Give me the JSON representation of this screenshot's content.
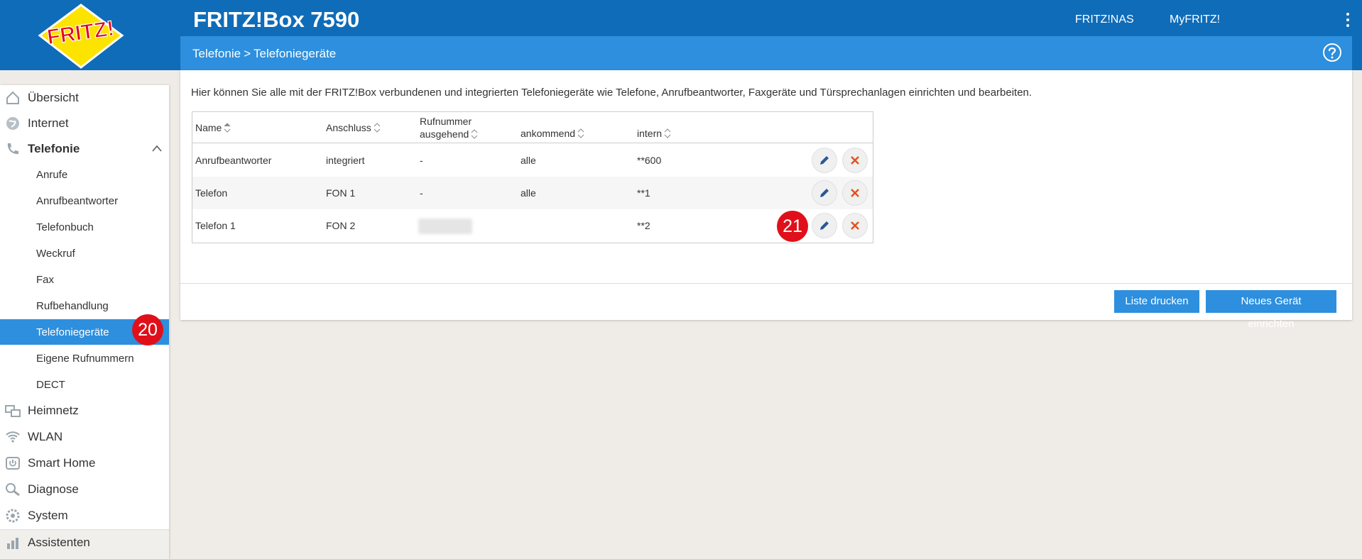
{
  "header": {
    "brand": "FRITZ!",
    "product": "FRITZ!Box 7590",
    "links": [
      "FRITZ!NAS",
      "MyFRITZ!"
    ]
  },
  "breadcrumb": {
    "parent": "Telefonie",
    "separator": ">",
    "current": "Telefoniegeräte"
  },
  "sidebar": {
    "items": [
      {
        "label": "Übersicht",
        "icon": "home-icon"
      },
      {
        "label": "Internet",
        "icon": "globe-icon"
      },
      {
        "label": "Telefonie",
        "icon": "phone-icon",
        "expanded": true
      },
      {
        "label": "Heimnetz",
        "icon": "network-icon"
      },
      {
        "label": "WLAN",
        "icon": "wifi-icon"
      },
      {
        "label": "Smart Home",
        "icon": "smarthome-icon"
      },
      {
        "label": "Diagnose",
        "icon": "diagnose-icon"
      },
      {
        "label": "System",
        "icon": "gear-icon"
      },
      {
        "label": "Assistenten",
        "icon": "wizard-icon"
      }
    ],
    "telefonie_sub": [
      "Anrufe",
      "Anrufbeantworter",
      "Telefonbuch",
      "Weckruf",
      "Fax",
      "Rufbehandlung",
      "Telefoniegeräte",
      "Eigene Rufnummern",
      "DECT"
    ],
    "selected_sub": "Telefoniegeräte"
  },
  "annotations": {
    "badge_a": "20",
    "badge_b": "21"
  },
  "main": {
    "intro": "Hier können Sie alle mit der FRITZ!Box verbundenen und integrierten Telefoniegeräte wie Telefone, Anrufbeantworter, Faxgeräte und Türsprechanlagen einrichten und bearbeiten.",
    "table": {
      "headers": {
        "name": "Name",
        "anschluss": "Anschluss",
        "rufnummer_line1": "Rufnummer",
        "rufnummer_line2": "ausgehend",
        "ankommend": "ankommend",
        "intern": "intern"
      },
      "rows": [
        {
          "name": "Anrufbeantworter",
          "anschluss": "integriert",
          "ausgehend": "-",
          "ankommend": "alle",
          "intern": "**600"
        },
        {
          "name": "Telefon",
          "anschluss": "FON 1",
          "ausgehend": "-",
          "ankommend": "alle",
          "intern": "**1"
        },
        {
          "name": "Telefon 1",
          "anschluss": "FON 2",
          "ausgehend": "",
          "ankommend": "",
          "intern": "**2"
        }
      ]
    },
    "buttons": {
      "print": "Liste drucken",
      "new_device": "Neues Gerät einrichten"
    }
  },
  "colors": {
    "topbar": "#0f6cb8",
    "accent": "#2d8fdd",
    "badge": "#e0101a",
    "edit_icon": "#2b5797",
    "delete_icon": "#e2531e"
  }
}
